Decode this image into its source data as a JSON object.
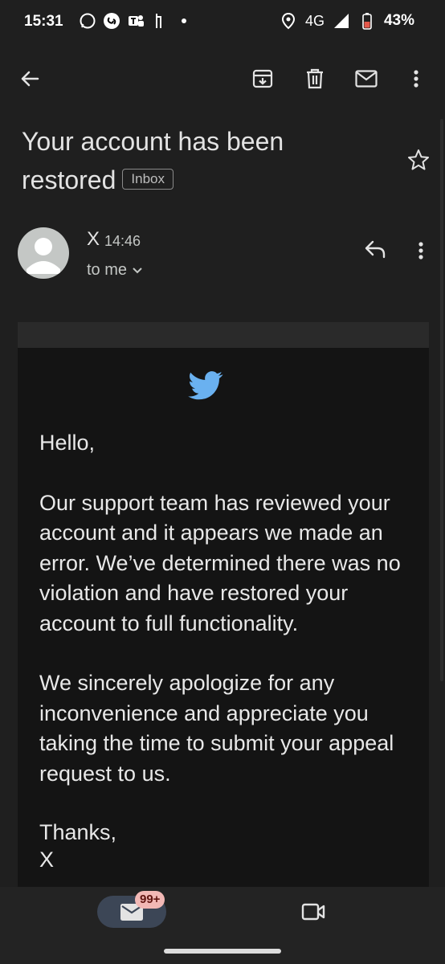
{
  "status_bar": {
    "time": "15:31",
    "network": "4G",
    "battery": "43%",
    "left_icons": [
      "whatsapp-icon",
      "shazam-icon",
      "teams-icon",
      "notification-icon",
      "dot-icon"
    ],
    "right_icons": [
      "location-icon",
      "signal-icon",
      "battery-icon"
    ]
  },
  "toolbar": {
    "icons": [
      "back-arrow-icon",
      "archive-icon",
      "delete-icon",
      "mark-unread-icon",
      "more-vert-icon"
    ]
  },
  "email": {
    "subject": "Your account has been restored",
    "label": "Inbox",
    "sender": "X",
    "time": "14:46",
    "recipient": "to me",
    "body": [
      "Hello,",
      "Our support team has reviewed your account and it appears we made an error. We’ve determined there was no violation and have restored your account to full functionality.",
      "We sincerely apologize for any inconvenience and appreciate you taking the time to submit your appeal request to us.",
      "Thanks,",
      "X"
    ]
  },
  "bottom_nav": {
    "mail_badge": "99+",
    "icons": [
      "mail-icon",
      "video-icon"
    ]
  },
  "colors": {
    "background": "#1f1f1f",
    "email_background": "#141414",
    "twitter_blue": "#6ab1f0",
    "badge": "#f2b8b5"
  }
}
